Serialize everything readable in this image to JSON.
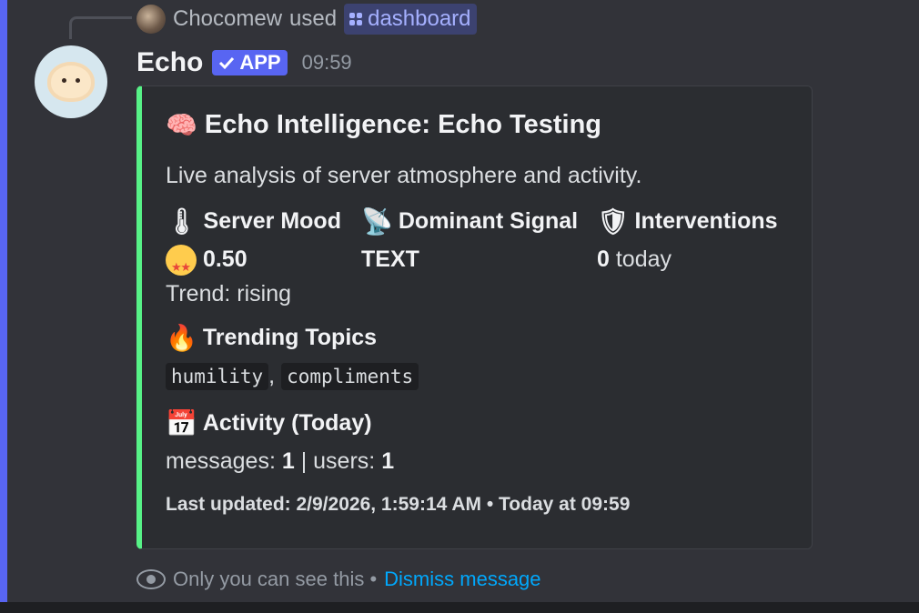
{
  "reply": {
    "user": "Chocomew",
    "used_text": "used",
    "command": "dashboard"
  },
  "message": {
    "author": "Echo",
    "badge": "APP",
    "time": "09:59"
  },
  "embed": {
    "accent_color": "#57f287",
    "title_emoji": "🧠",
    "title": "Echo Intelligence: Echo Testing",
    "description": "Live analysis of server atmosphere and activity.",
    "fields": [
      {
        "emoji": "🌡",
        "name": "Server Mood",
        "value": "0.50",
        "extra": "Trend: rising"
      },
      {
        "emoji": "📡",
        "name": "Dominant Signal",
        "value": "TEXT"
      },
      {
        "emoji": "🛡",
        "name": "Interventions",
        "value": "0",
        "suffix": "today"
      }
    ],
    "trending": {
      "emoji": "🔥",
      "name": "Trending Topics",
      "topics": [
        "humility",
        "compliments"
      ],
      "separator": ","
    },
    "activity": {
      "emoji": "📅",
      "name": "Activity (Today)",
      "messages_label": "messages:",
      "messages": "1",
      "users_label": "| users:",
      "users": "1"
    },
    "footer": "Last updated: 2/9/2026, 1:59:14 AM • Today at 09:59"
  },
  "ephemeral": {
    "text": "Only you can see this •",
    "dismiss": "Dismiss message"
  },
  "icons": {
    "eye": "eye-icon",
    "check": "check-icon",
    "command": "slash-command-icon"
  }
}
